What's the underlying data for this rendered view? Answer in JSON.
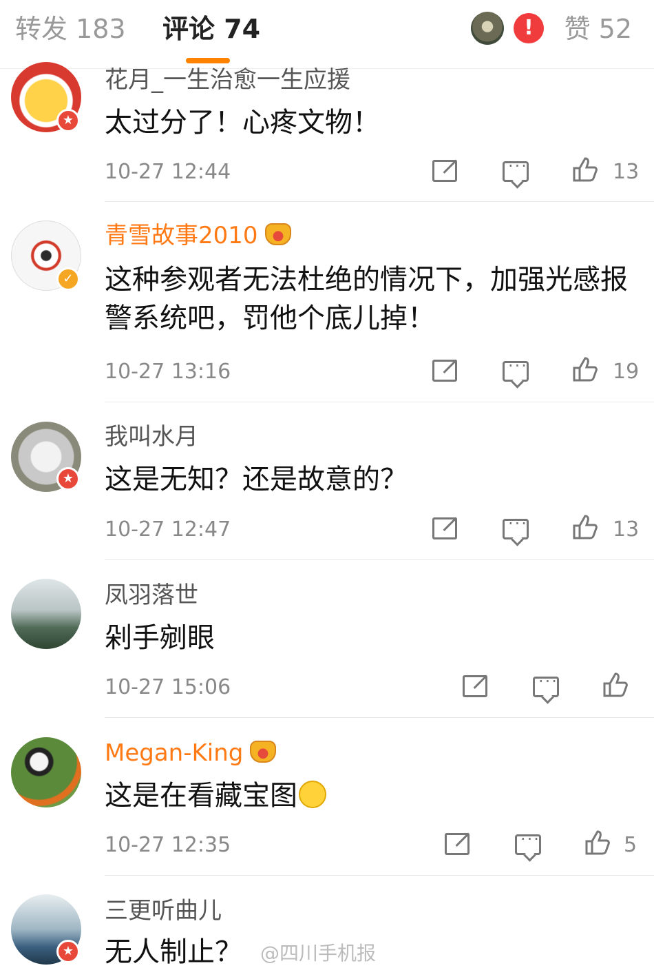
{
  "tabs": {
    "repost": "转发 183",
    "comments": "评论 74",
    "likes": "赞 52",
    "alert": "!"
  },
  "comments": [
    {
      "name": "花月_一生治愈一生应援",
      "text": "太过分了！心疼文物！",
      "time": "10-27 12:44",
      "likes": "13"
    },
    {
      "name": "青雪故事2010",
      "text": "这种参观者无法杜绝的情况下，加强光感报警系统吧，罚他个底儿掉！",
      "time": "10-27 13:16",
      "likes": "19"
    },
    {
      "name": "我叫水月",
      "text": "这是无知？还是故意的？",
      "time": "10-27 12:47",
      "likes": "13"
    },
    {
      "name": "凤羽落世",
      "text": "剁手剜眼",
      "time": "10-27 15:06",
      "likes": ""
    },
    {
      "name": "Megan-King",
      "text": "这是在看藏宝图",
      "time": "10-27 12:35",
      "likes": "5"
    },
    {
      "name": "三更听曲儿",
      "text": "无人制止？",
      "time": "",
      "likes": ""
    }
  ],
  "badges": {
    "verified": "✓",
    "member": "★"
  },
  "watermark": "@四川手机报",
  "colors": {
    "accent": "#ff8200",
    "vip_name": "#ff7a14",
    "badge_red": "#e8483a",
    "badge_gold": "#f5a623"
  }
}
